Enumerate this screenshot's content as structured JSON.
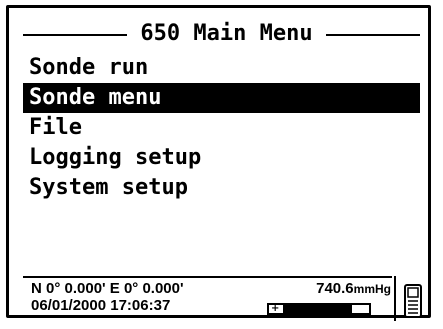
{
  "title": "650 Main Menu",
  "menu": {
    "items": [
      {
        "label": "Sonde run",
        "selected": false
      },
      {
        "label": "Sonde menu",
        "selected": true
      },
      {
        "label": "File",
        "selected": false
      },
      {
        "label": "Logging setup",
        "selected": false
      },
      {
        "label": "System setup",
        "selected": false
      }
    ]
  },
  "status": {
    "gps": "N 0° 0.000' E  0° 0.000'",
    "datetime": "06/01/2000 17:06:37",
    "pressure_value": "740.6",
    "pressure_unit": "mmHg",
    "battery_level": 0.8,
    "battery_icon": "battery-icon",
    "device_icon": "handheld-device-icon"
  }
}
